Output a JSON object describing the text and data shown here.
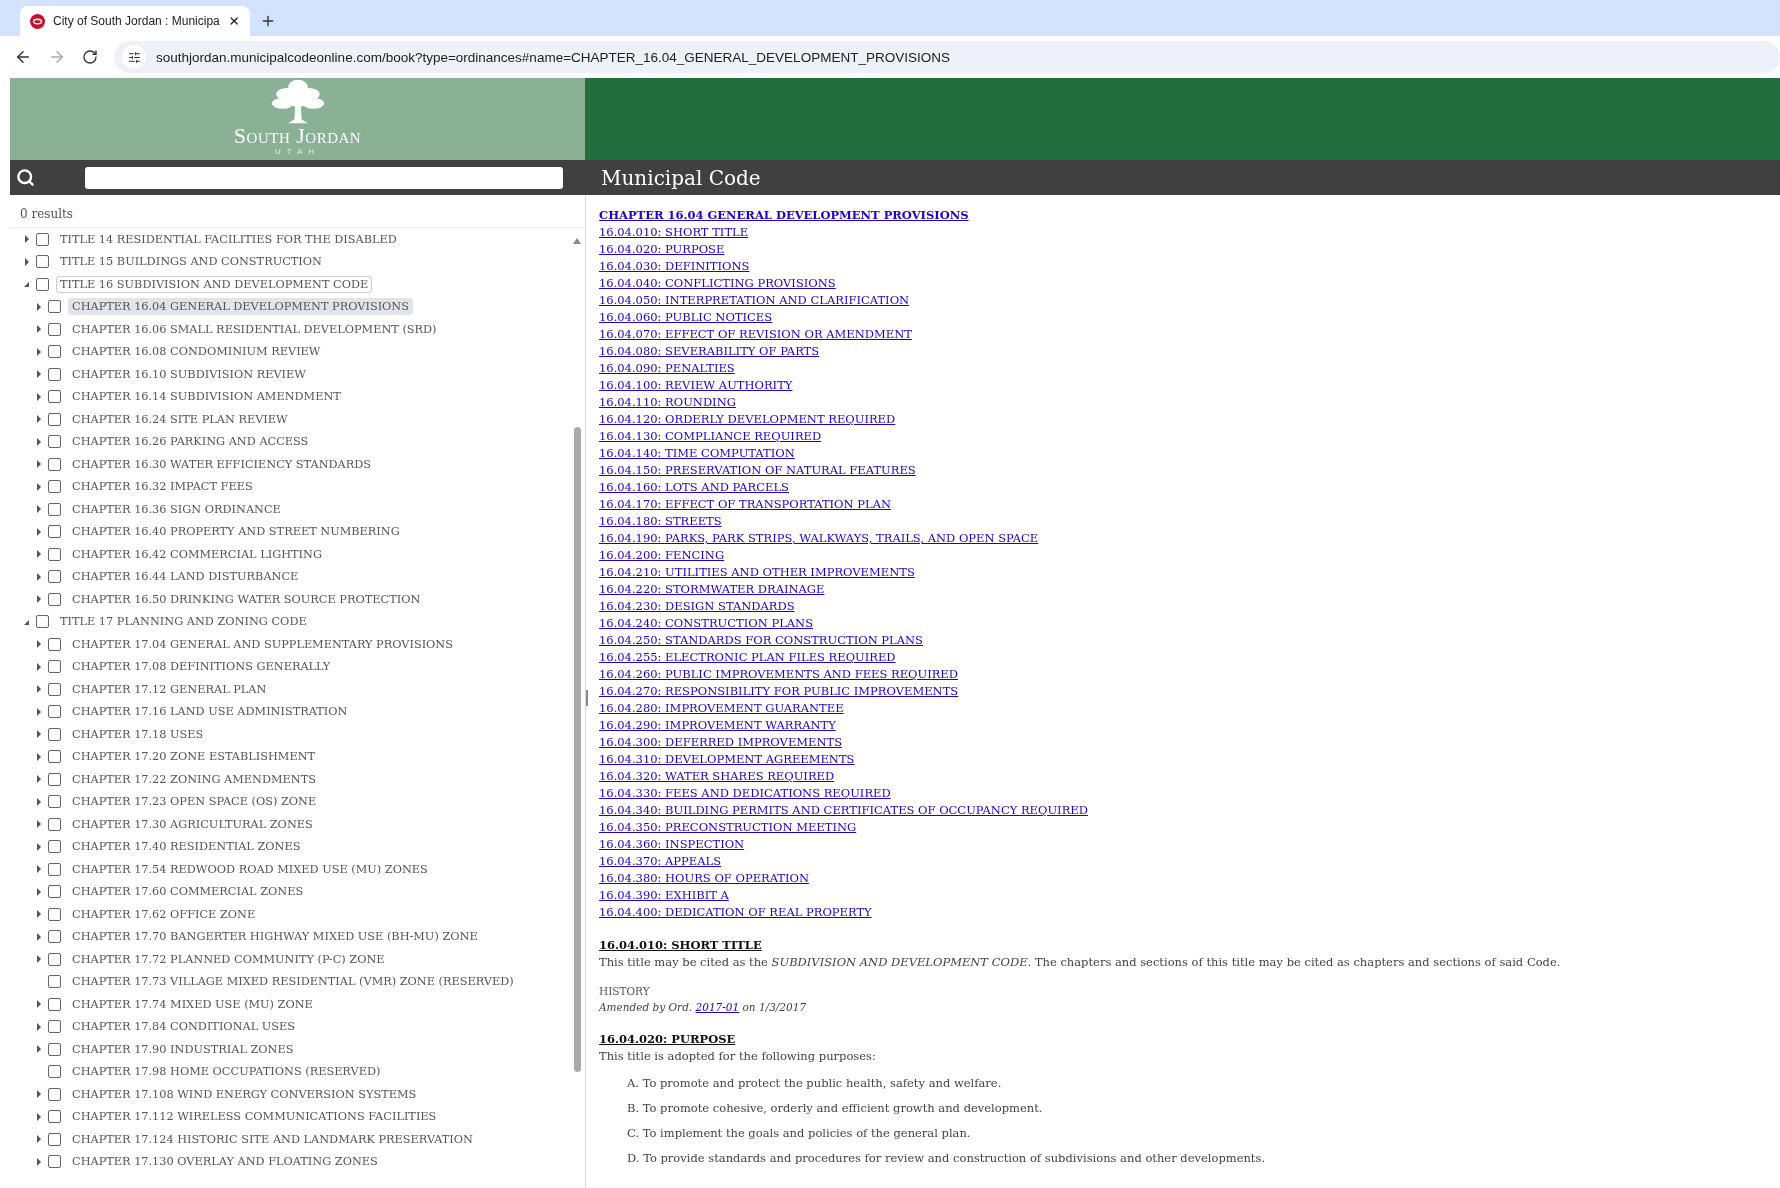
{
  "browser": {
    "tab": {
      "title": "City of South Jordan : Municipa",
      "selected": true
    },
    "url": "southjordan.municipalcodeonline.com/book?type=ordinances#name=CHAPTER_16.04_GENERAL_DEVELOPMENT_PROVISIONS"
  },
  "header": {
    "logo_name": "South Jordan",
    "logo_tagline": "UTAH",
    "page_title": "Municipal Code"
  },
  "search": {
    "results": "0 results"
  },
  "tree": [
    {
      "label": "TITLE 14 RESIDENTIAL FACILITIES FOR THE DISABLED",
      "kind": "branch",
      "expanded": false,
      "checked": false,
      "selected": false,
      "focused": false
    },
    {
      "label": "TITLE 15 BUILDINGS AND CONSTRUCTION",
      "kind": "branch",
      "expanded": false,
      "checked": false,
      "selected": false,
      "focused": false
    },
    {
      "label": "TITLE 16 SUBDIVISION AND DEVELOPMENT CODE",
      "kind": "branch",
      "expanded": true,
      "checked": false,
      "selected": false,
      "focused": true,
      "children": [
        {
          "label": "CHAPTER 16.04 GENERAL DEVELOPMENT PROVISIONS",
          "kind": "branch",
          "expanded": false,
          "checked": false,
          "selected": true,
          "focused": false
        },
        {
          "label": "CHAPTER 16.06 SMALL RESIDENTIAL DEVELOPMENT (SRD)",
          "kind": "branch",
          "expanded": false,
          "checked": false,
          "selected": false,
          "focused": false
        },
        {
          "label": "CHAPTER 16.08 CONDOMINIUM REVIEW",
          "kind": "branch",
          "expanded": false,
          "checked": false,
          "selected": false,
          "focused": false
        },
        {
          "label": "CHAPTER 16.10 SUBDIVISION REVIEW",
          "kind": "branch",
          "expanded": false,
          "checked": false,
          "selected": false,
          "focused": false
        },
        {
          "label": "CHAPTER 16.14 SUBDIVISION AMENDMENT",
          "kind": "branch",
          "expanded": false,
          "checked": false,
          "selected": false,
          "focused": false
        },
        {
          "label": "CHAPTER 16.24 SITE PLAN REVIEW",
          "kind": "branch",
          "expanded": false,
          "checked": false,
          "selected": false,
          "focused": false
        },
        {
          "label": "CHAPTER 16.26 PARKING AND ACCESS",
          "kind": "branch",
          "expanded": false,
          "checked": false,
          "selected": false,
          "focused": false
        },
        {
          "label": "CHAPTER 16.30 WATER EFFICIENCY STANDARDS",
          "kind": "branch",
          "expanded": false,
          "checked": false,
          "selected": false,
          "focused": false
        },
        {
          "label": "CHAPTER 16.32 IMPACT FEES",
          "kind": "branch",
          "expanded": false,
          "checked": false,
          "selected": false,
          "focused": false
        },
        {
          "label": "CHAPTER 16.36 SIGN ORDINANCE",
          "kind": "branch",
          "expanded": false,
          "checked": false,
          "selected": false,
          "focused": false
        },
        {
          "label": "CHAPTER 16.40 PROPERTY AND STREET NUMBERING",
          "kind": "branch",
          "expanded": false,
          "checked": false,
          "selected": false,
          "focused": false
        },
        {
          "label": "CHAPTER 16.42 COMMERCIAL LIGHTING",
          "kind": "branch",
          "expanded": false,
          "checked": false,
          "selected": false,
          "focused": false
        },
        {
          "label": "CHAPTER 16.44 LAND DISTURBANCE",
          "kind": "branch",
          "expanded": false,
          "checked": false,
          "selected": false,
          "focused": false
        },
        {
          "label": "CHAPTER 16.50 DRINKING WATER SOURCE PROTECTION",
          "kind": "branch",
          "expanded": false,
          "checked": false,
          "selected": false,
          "focused": false
        }
      ]
    },
    {
      "label": "TITLE 17 PLANNING AND ZONING CODE",
      "kind": "branch",
      "expanded": true,
      "checked": false,
      "selected": false,
      "focused": false,
      "children": [
        {
          "label": "CHAPTER 17.04 GENERAL AND SUPPLEMENTARY PROVISIONS",
          "kind": "branch",
          "expanded": false,
          "checked": false,
          "selected": false,
          "focused": false
        },
        {
          "label": "CHAPTER 17.08 DEFINITIONS GENERALLY",
          "kind": "branch",
          "expanded": false,
          "checked": false,
          "selected": false,
          "focused": false
        },
        {
          "label": "CHAPTER 17.12 GENERAL PLAN",
          "kind": "branch",
          "expanded": false,
          "checked": false,
          "selected": false,
          "focused": false
        },
        {
          "label": "CHAPTER 17.16 LAND USE ADMINISTRATION",
          "kind": "branch",
          "expanded": false,
          "checked": false,
          "selected": false,
          "focused": false
        },
        {
          "label": "CHAPTER 17.18 USES",
          "kind": "branch",
          "expanded": false,
          "checked": false,
          "selected": false,
          "focused": false
        },
        {
          "label": "CHAPTER 17.20 ZONE ESTABLISHMENT",
          "kind": "branch",
          "expanded": false,
          "checked": false,
          "selected": false,
          "focused": false
        },
        {
          "label": "CHAPTER 17.22 ZONING AMENDMENTS",
          "kind": "branch",
          "expanded": false,
          "checked": false,
          "selected": false,
          "focused": false
        },
        {
          "label": "CHAPTER 17.23 OPEN SPACE (OS) ZONE",
          "kind": "branch",
          "expanded": false,
          "checked": false,
          "selected": false,
          "focused": false
        },
        {
          "label": "CHAPTER 17.30 AGRICULTURAL ZONES",
          "kind": "branch",
          "expanded": false,
          "checked": false,
          "selected": false,
          "focused": false
        },
        {
          "label": "CHAPTER 17.40 RESIDENTIAL ZONES",
          "kind": "branch",
          "expanded": false,
          "checked": false,
          "selected": false,
          "focused": false
        },
        {
          "label": "CHAPTER 17.54 REDWOOD ROAD MIXED USE (MU) ZONES",
          "kind": "branch",
          "expanded": false,
          "checked": false,
          "selected": false,
          "focused": false
        },
        {
          "label": "CHAPTER 17.60 COMMERCIAL ZONES",
          "kind": "branch",
          "expanded": false,
          "checked": false,
          "selected": false,
          "focused": false
        },
        {
          "label": "CHAPTER 17.62 OFFICE ZONE",
          "kind": "branch",
          "expanded": false,
          "checked": false,
          "selected": false,
          "focused": false
        },
        {
          "label": "CHAPTER 17.70 BANGERTER HIGHWAY MIXED USE (BH-MU) ZONE",
          "kind": "branch",
          "expanded": false,
          "checked": false,
          "selected": false,
          "focused": false
        },
        {
          "label": "CHAPTER 17.72 PLANNED COMMUNITY (P-C) ZONE",
          "kind": "branch",
          "expanded": false,
          "checked": false,
          "selected": false,
          "focused": false
        },
        {
          "label": "CHAPTER 17.73 VILLAGE MIXED RESIDENTIAL (VMR) ZONE (RESERVED)",
          "kind": "leaf",
          "checked": false,
          "selected": false,
          "focused": false
        },
        {
          "label": "CHAPTER 17.74 MIXED USE (MU) ZONE",
          "kind": "branch",
          "expanded": false,
          "checked": false,
          "selected": false,
          "focused": false
        },
        {
          "label": "CHAPTER 17.84 CONDITIONAL USES",
          "kind": "branch",
          "expanded": false,
          "checked": false,
          "selected": false,
          "focused": false
        },
        {
          "label": "CHAPTER 17.90 INDUSTRIAL ZONES",
          "kind": "branch",
          "expanded": false,
          "checked": false,
          "selected": false,
          "focused": false
        },
        {
          "label": "CHAPTER 17.98 HOME OCCUPATIONS (RESERVED)",
          "kind": "leaf",
          "checked": false,
          "selected": false,
          "focused": false
        },
        {
          "label": "CHAPTER 17.108 WIND ENERGY CONVERSION SYSTEMS",
          "kind": "branch",
          "expanded": false,
          "checked": false,
          "selected": false,
          "focused": false
        },
        {
          "label": "CHAPTER 17.112 WIRELESS COMMUNICATIONS FACILITIES",
          "kind": "branch",
          "expanded": false,
          "checked": false,
          "selected": false,
          "focused": false
        },
        {
          "label": "CHAPTER 17.124 HISTORIC SITE AND LANDMARK PRESERVATION",
          "kind": "branch",
          "expanded": false,
          "checked": false,
          "selected": false,
          "focused": false
        },
        {
          "label": "CHAPTER 17.130 OVERLAY AND FLOATING ZONES",
          "kind": "branch",
          "expanded": false,
          "checked": false,
          "selected": false,
          "focused": false
        }
      ]
    }
  ],
  "contents": {
    "heading": "CHAPTER 16.04 GENERAL DEVELOPMENT PROVISIONS",
    "links": [
      "16.04.010: SHORT TITLE",
      "16.04.020: PURPOSE",
      "16.04.030: DEFINITIONS",
      "16.04.040: CONFLICTING PROVISIONS",
      "16.04.050: INTERPRETATION AND CLARIFICATION",
      "16.04.060: PUBLIC NOTICES",
      "16.04.070: EFFECT OF REVISION OR AMENDMENT",
      "16.04.080: SEVERABILITY OF PARTS",
      "16.04.090: PENALTIES",
      "16.04.100: REVIEW AUTHORITY",
      "16.04.110: ROUNDING",
      "16.04.120: ORDERLY DEVELOPMENT REQUIRED",
      "16.04.130: COMPLIANCE REQUIRED",
      "16.04.140: TIME COMPUTATION",
      "16.04.150: PRESERVATION OF NATURAL FEATURES",
      "16.04.160: LOTS AND PARCELS",
      "16.04.170: EFFECT OF TRANSPORTATION PLAN",
      "16.04.180: STREETS",
      "16.04.190: PARKS, PARK STRIPS, WALKWAYS, TRAILS, AND OPEN SPACE",
      "16.04.200: FENCING",
      "16.04.210: UTILITIES AND OTHER IMPROVEMENTS",
      "16.04.220: STORMWATER DRAINAGE",
      "16.04.230: DESIGN STANDARDS",
      "16.04.240: CONSTRUCTION PLANS",
      "16.04.250: STANDARDS FOR CONSTRUCTION PLANS",
      "16.04.255: ELECTRONIC PLAN FILES REQUIRED",
      "16.04.260: PUBLIC IMPROVEMENTS AND FEES REQUIRED",
      "16.04.270: RESPONSIBILITY FOR PUBLIC IMPROVEMENTS",
      "16.04.280: IMPROVEMENT GUARANTEE",
      "16.04.290: IMPROVEMENT WARRANTY",
      "16.04.300: DEFERRED IMPROVEMENTS",
      "16.04.310: DEVELOPMENT AGREEMENTS",
      "16.04.320: WATER SHARES REQUIRED",
      "16.04.330: FEES AND DEDICATIONS REQUIRED",
      "16.04.340: BUILDING PERMITS AND CERTIFICATES OF OCCUPANCY REQUIRED",
      "16.04.350: PRECONSTRUCTION MEETING",
      "16.04.360: INSPECTION",
      "16.04.370: APPEALS",
      "16.04.380: HOURS OF OPERATION",
      "16.04.390: EXHIBIT A",
      "16.04.400: DEDICATION OF REAL PROPERTY"
    ]
  },
  "sections": [
    {
      "title": "16.04.010: SHORT TITLE",
      "body": "This title may be cited as the *SUBDIVISION AND DEVELOPMENT CODE*. The chapters and sections of this title may be cited as chapters and sections of said Code.",
      "history": {
        "label": "HISTORY",
        "before": "Amended by Ord.",
        "link": "2017-01",
        "after": "on 1/3/2017"
      }
    },
    {
      "title": "16.04.020: PURPOSE",
      "body": "This title is adopted for the following purposes:",
      "items": [
        {
          "marker": "A.",
          "text": "To promote and protect the public health, safety and welfare."
        },
        {
          "marker": "B.",
          "text": "To promote cohesive, orderly and efficient growth and development."
        },
        {
          "marker": "C.",
          "text": "To implement the goals and policies of the general plan."
        },
        {
          "marker": "D.",
          "text": "To provide standards and procedures for review and construction of subdivisions and other developments."
        }
      ]
    }
  ]
}
